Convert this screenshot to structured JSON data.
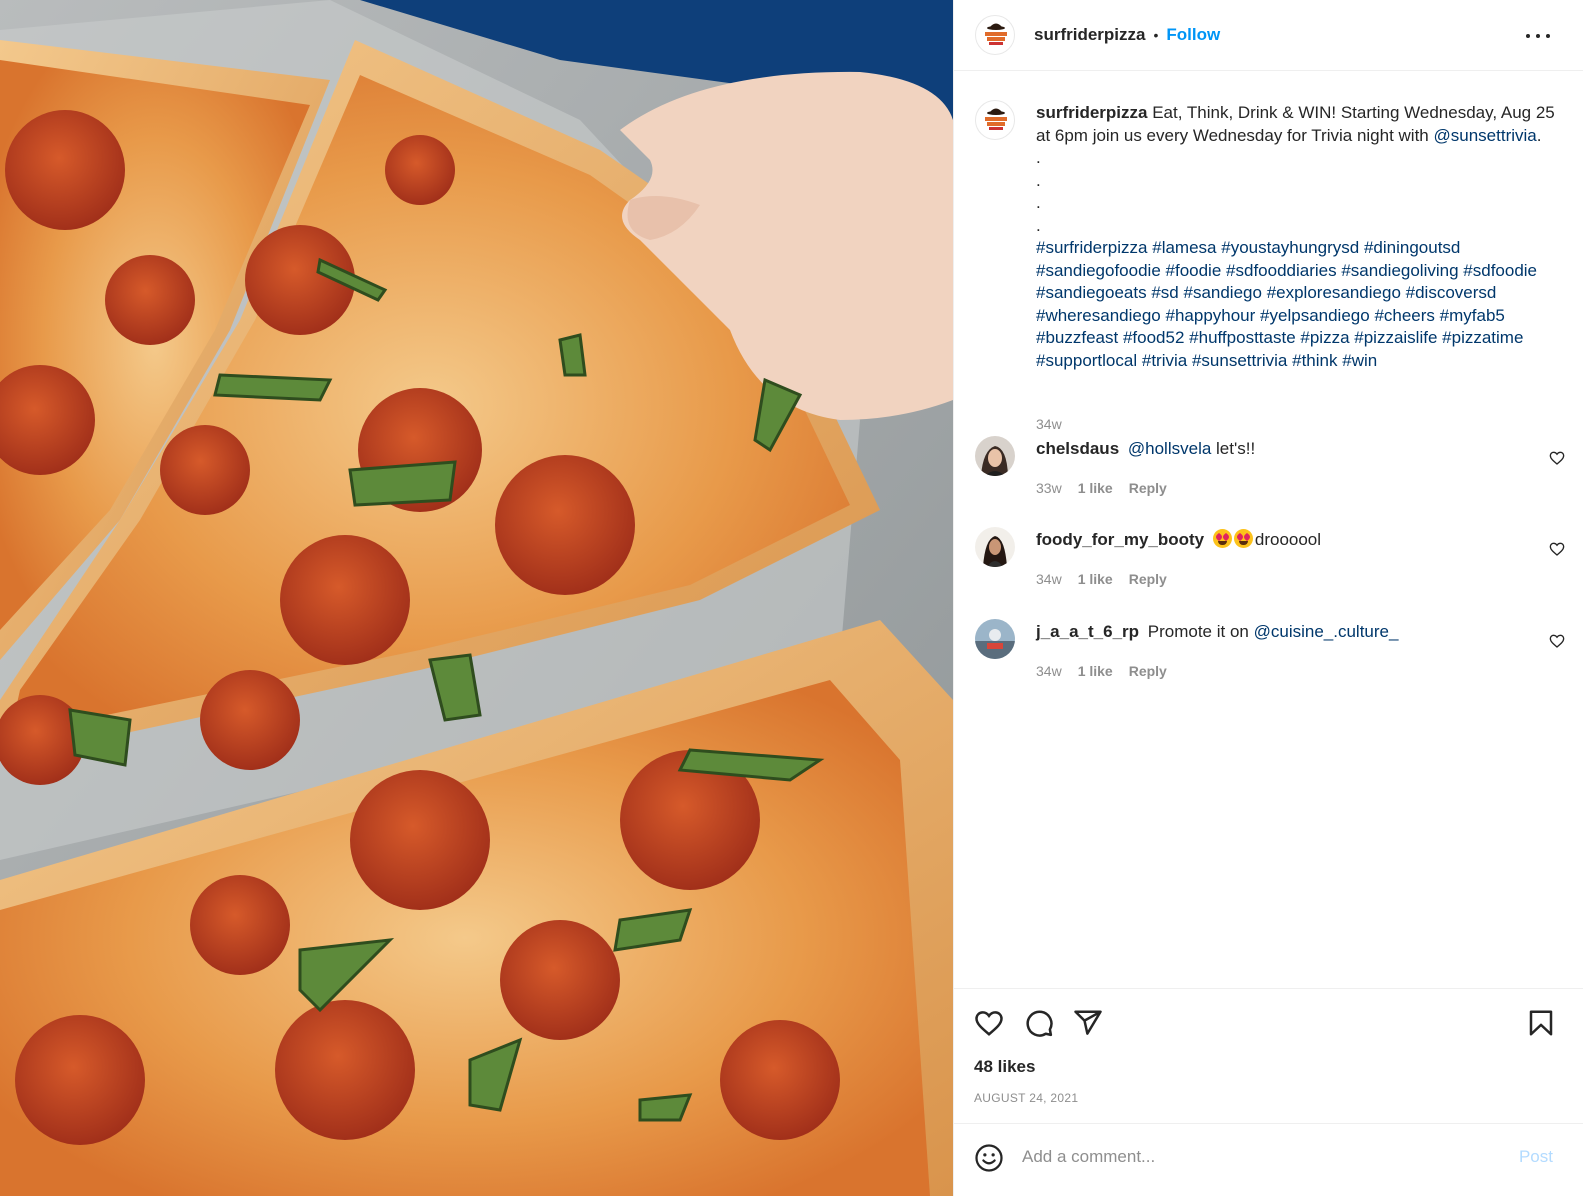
{
  "post": {
    "username": "surfriderpizza",
    "separator": "•",
    "follow_label": "Follow",
    "photo_alt": "Pepperoni pizza with basil, a hand lifting a slice"
  },
  "caption": {
    "username": "surfriderpizza",
    "text_before_mention": "Eat, Think, Drink & WIN! Starting Wednesday, Aug 25 at 6pm join us every Wednesday for Trivia night with",
    "mention": "@sunsettrivia",
    "text_after_mention": ".",
    "dots": [
      ".",
      ".",
      ".",
      "."
    ],
    "hashtags": [
      "#surfriderpizza",
      "#lamesa",
      "#youstayhungrysd",
      "#diningoutsd",
      "#sandiegofoodie",
      "#foodie",
      "#sdfooddiaries",
      "#sandiegoliving",
      "#sdfoodie",
      "#sandiegoeats",
      "#sd",
      "#sandiego",
      "#exploresandiego",
      "#discoversd",
      "#wheresandiego",
      "#happyhour",
      "#yelpsandiego",
      "#cheers",
      "#myfab5",
      "#buzzfeast",
      "#food52",
      "#huffposttaste",
      "#pizza",
      "#pizzaislife",
      "#pizzatime",
      "#supportlocal",
      "#trivia",
      "#sunsettrivia",
      "#think",
      "#win"
    ],
    "time": "34w"
  },
  "comments": [
    {
      "username": "chelsdaus",
      "mention": "@hollsvela",
      "text": "let's!!",
      "time": "33w",
      "likes": "1 like",
      "reply": "Reply"
    },
    {
      "username": "foody_for_my_booty",
      "mention": "",
      "text": "droooool",
      "time": "34w",
      "likes": "1 like",
      "reply": "Reply"
    },
    {
      "username": "j_a_a_t_6_rp",
      "prefix": "Promote it on",
      "mention": "@cuisine_.culture_",
      "text": "",
      "time": "34w",
      "likes": "1 like",
      "reply": "Reply"
    }
  ],
  "actions": {
    "likes": "48 likes",
    "date": "AUGUST 24, 2021"
  },
  "add_comment": {
    "placeholder": "Add a comment...",
    "post_label": "Post"
  },
  "colors": {
    "accent": "#0095f6",
    "link": "#00376b",
    "muted": "#8e8e8e",
    "text": "#262626",
    "border": "#efefef"
  },
  "icons": [
    "more-options-icon",
    "heart-icon",
    "comment-icon",
    "share-icon",
    "bookmark-icon",
    "smiley-icon"
  ]
}
